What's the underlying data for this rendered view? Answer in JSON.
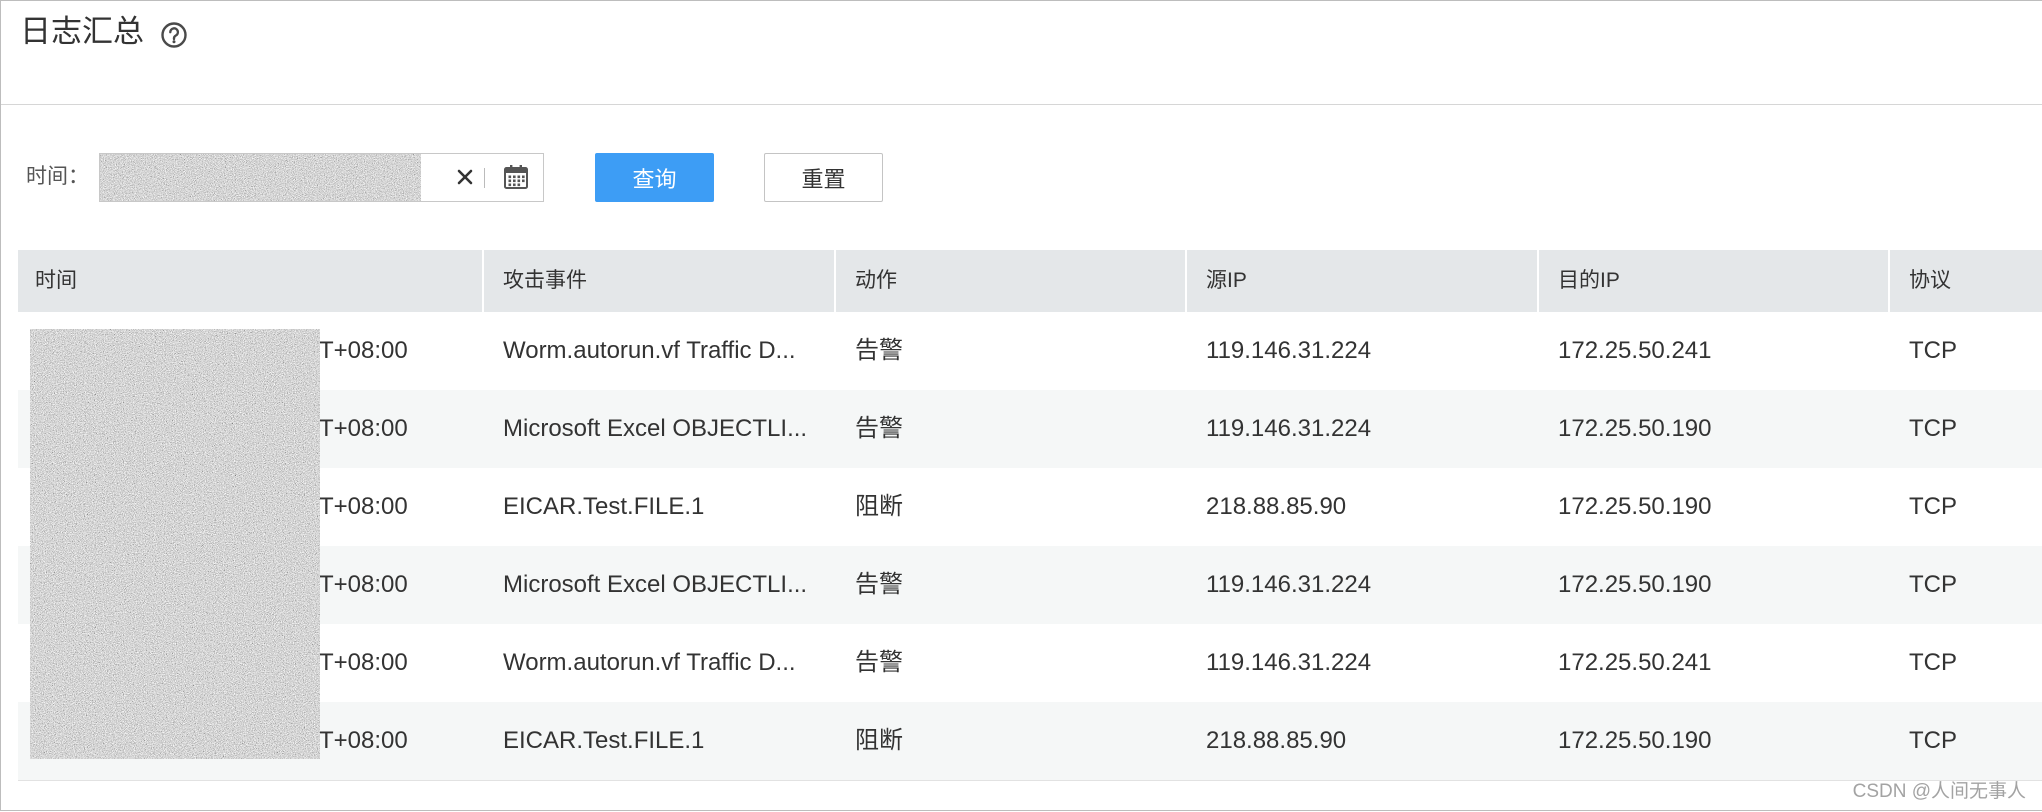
{
  "page": {
    "title": "日志汇总",
    "help_icon": "question-circle-icon"
  },
  "filter": {
    "time_label": "时间：",
    "clear_icon": "close-icon",
    "calendar_icon": "calendar-icon",
    "query_label": "查询",
    "reset_label": "重置"
  },
  "table": {
    "columns": [
      "时间",
      "攻击事件",
      "动作",
      "源IP",
      "目的IP",
      "协议"
    ],
    "rows": [
      {
        "time": "T+08:00",
        "event": "Worm.autorun.vf Traffic D...",
        "action": "告警",
        "src_ip": "119.146.31.224",
        "dst_ip": "172.25.50.241",
        "protocol": "TCP"
      },
      {
        "time": "T+08:00",
        "event": "Microsoft Excel OBJECTLI...",
        "action": "告警",
        "src_ip": "119.146.31.224",
        "dst_ip": "172.25.50.190",
        "protocol": "TCP"
      },
      {
        "time": "T+08:00",
        "event": "EICAR.Test.FILE.1",
        "action": "阻断",
        "src_ip": "218.88.85.90",
        "dst_ip": "172.25.50.190",
        "protocol": "TCP"
      },
      {
        "time": "T+08:00",
        "event": "Microsoft Excel OBJECTLI...",
        "action": "告警",
        "src_ip": "119.146.31.224",
        "dst_ip": "172.25.50.190",
        "protocol": "TCP"
      },
      {
        "time": "T+08:00",
        "event": "Worm.autorun.vf Traffic D...",
        "action": "告警",
        "src_ip": "119.146.31.224",
        "dst_ip": "172.25.50.241",
        "protocol": "TCP"
      },
      {
        "time": "T+08:00",
        "event": "EICAR.Test.FILE.1",
        "action": "阻断",
        "src_ip": "218.88.85.90",
        "dst_ip": "172.25.50.190",
        "protocol": "TCP"
      }
    ]
  },
  "watermark": "CSDN @人间无事人",
  "colors": {
    "primary_button": "#3d9df5",
    "table_header_bg": "#e4e7e9",
    "stripe_row_bg": "#f5f7f7",
    "text": "#333333"
  }
}
